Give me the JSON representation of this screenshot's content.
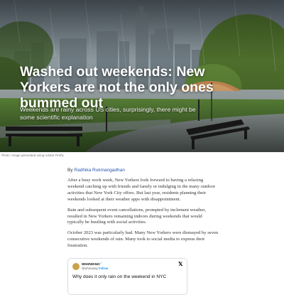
{
  "hero": {
    "title": "Washed out weekends: New Yorkers are not the only ones bummed out",
    "subtitle": "Weekends are rainy across US cities, surprisingly, there might be some scientific explanation",
    "image_credit": "Photo: Image generated using Adobe Firefly"
  },
  "article": {
    "byline_prefix": "By ",
    "author": "Radhika Rukmangadhan",
    "paragraphs": [
      "After a busy work week, New Yorkers look forward to having a relaxing weekend catching up with friends and family or indulging in the many outdoor activities that New York City offers. But last year, residents planning their weekends looked at their weather apps with disappointment.",
      "Rain and subsequent event cancellations, prompted by inclement weather, resulted in New Yorkers remaining indoors during weekends that would typically be bustling with social activities.",
      "October 2023 was particularly bad. Many New Yorkers were dismayed by seven consecutive weekends of rain. Many took to social media to express their frustration."
    ]
  },
  "tweet": {
    "name": "WHIZWANG",
    "badges": "✓",
    "handle": "@whizwang",
    "follow_label": "Follow",
    "close_icon": "x-icon",
    "text": "Why does it only rain on the weekend in NYC"
  }
}
